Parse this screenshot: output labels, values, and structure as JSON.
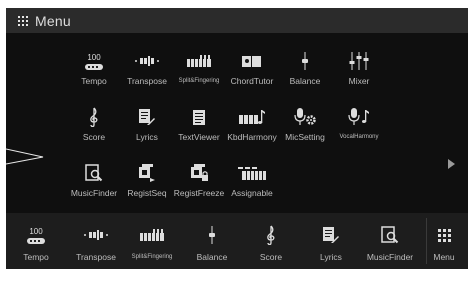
{
  "title": "Menu",
  "apps": [
    {
      "label": "Tempo",
      "icon": "tempo-icon",
      "value": "100"
    },
    {
      "label": "Transpose",
      "icon": "transpose-icon"
    },
    {
      "label": "Split&Fingering",
      "icon": "split-fingering-icon"
    },
    {
      "label": "ChordTutor",
      "icon": "chord-tutor-icon"
    },
    {
      "label": "Balance",
      "icon": "balance-icon"
    },
    {
      "label": "Mixer",
      "icon": "mixer-icon"
    },
    {
      "label": "Score",
      "icon": "score-icon"
    },
    {
      "label": "Lyrics",
      "icon": "lyrics-icon"
    },
    {
      "label": "TextViewer",
      "icon": "text-viewer-icon"
    },
    {
      "label": "KbdHarmony",
      "icon": "kbd-harmony-icon"
    },
    {
      "label": "MicSetting",
      "icon": "mic-setting-icon"
    },
    {
      "label": "VocalHarmony",
      "icon": "vocal-harmony-icon"
    },
    {
      "label": "MusicFinder",
      "icon": "music-finder-icon"
    },
    {
      "label": "RegistSeq",
      "icon": "regist-seq-icon"
    },
    {
      "label": "RegistFreeze",
      "icon": "regist-freeze-icon"
    },
    {
      "label": "Assignable",
      "icon": "assignable-icon"
    }
  ],
  "bottom": [
    {
      "label": "Tempo",
      "value": "100"
    },
    {
      "label": "Transpose"
    },
    {
      "label": "Split&Fingering"
    },
    {
      "label": "Balance"
    },
    {
      "label": "Score"
    },
    {
      "label": "Lyrics"
    },
    {
      "label": "MusicFinder"
    },
    {
      "label": "Menu"
    }
  ]
}
